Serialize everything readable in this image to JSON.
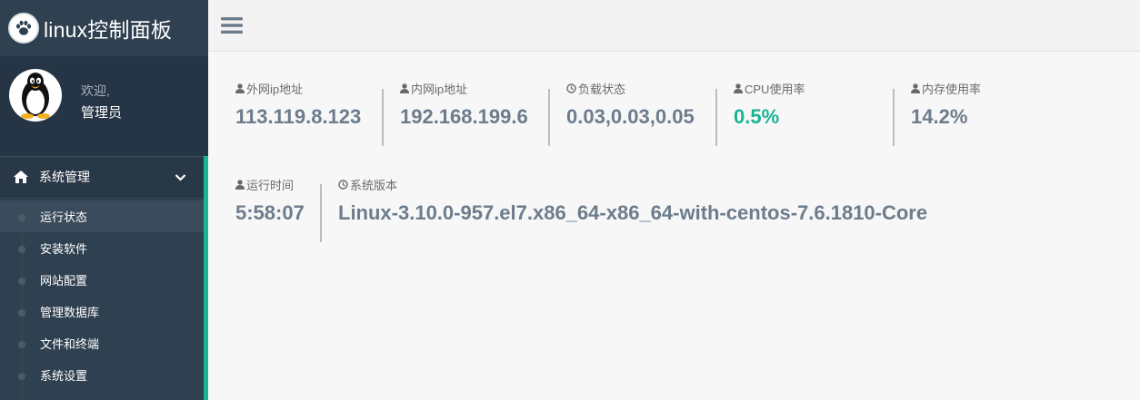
{
  "brand": {
    "title": "linux控制面板"
  },
  "profile": {
    "welcome": "欢迎,",
    "role": "管理员"
  },
  "nav": {
    "group_label": "系统管理",
    "items": [
      {
        "label": "运行状态",
        "active": true
      },
      {
        "label": "安装软件",
        "active": false
      },
      {
        "label": "网站配置",
        "active": false
      },
      {
        "label": "管理数据库",
        "active": false
      },
      {
        "label": "文件和终端",
        "active": false
      },
      {
        "label": "系统设置",
        "active": false
      }
    ]
  },
  "stats": {
    "external_ip": {
      "label": "外网ip地址",
      "value": "113.119.8.123",
      "icon": "user-icon"
    },
    "internal_ip": {
      "label": "内网ip地址",
      "value": "192.168.199.6",
      "icon": "user-icon"
    },
    "load": {
      "label": "负载状态",
      "value": "0.03,0.03,0.05",
      "icon": "clock-icon"
    },
    "cpu": {
      "label": "CPU使用率",
      "value": "0.5%",
      "icon": "user-icon"
    },
    "memory": {
      "label": "内存使用率",
      "value": "14.2%",
      "icon": "user-icon"
    },
    "uptime": {
      "label": "运行时间",
      "value": "5:58:07",
      "icon": "user-icon"
    },
    "version": {
      "label": "系统版本",
      "value": "Linux-3.10.0-957.el7.x86_64-x86_64-with-centos-7.6.1810-Core",
      "icon": "clock-icon"
    }
  },
  "colors": {
    "sidebar": "#2f4050",
    "accent": "#1ab394",
    "stat_value": "#6d7c8c"
  }
}
